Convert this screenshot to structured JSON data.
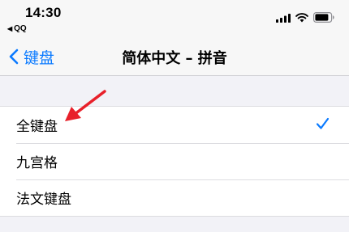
{
  "status_bar": {
    "time": "14:30",
    "back_app": "QQ",
    "back_icon": "back-triangle",
    "icons": [
      "cellular-signal-icon",
      "wifi-icon",
      "battery-icon"
    ]
  },
  "nav": {
    "back_label": "键盘",
    "title": "简体中文 – 拼音"
  },
  "options": [
    {
      "label": "全键盘",
      "selected": true
    },
    {
      "label": "九宫格",
      "selected": false
    },
    {
      "label": "法文键盘",
      "selected": false
    }
  ],
  "colors": {
    "accent": "#0a7aff",
    "background": "#f2f2f7",
    "annotation_arrow": "#e8202a"
  }
}
